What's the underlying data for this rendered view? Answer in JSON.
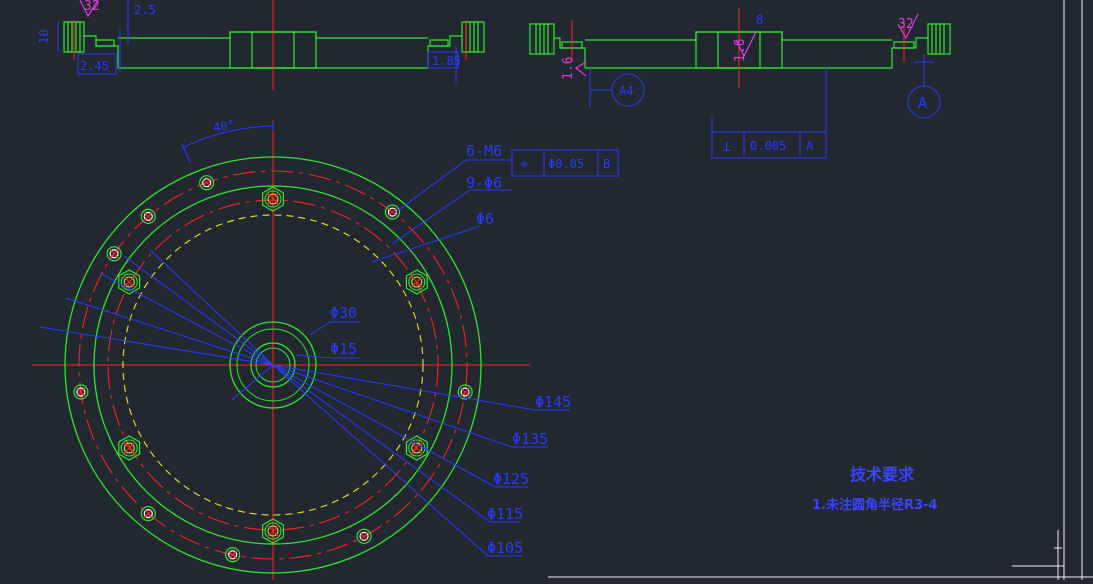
{
  "colors": {
    "background": "#212830",
    "outline": "#2ee82e",
    "centerline": "#ff2424",
    "dimension": "#2b3cff",
    "surface_finish": "#e23ce0",
    "hidden": "#e8e82a",
    "hole": "#ffffff"
  },
  "top_left_view": {
    "dims": {
      "height": "10",
      "gap": "2.5",
      "chamfer": "2.45",
      "right_detail": "1.85",
      "roughness": "32"
    }
  },
  "top_right_view": {
    "dims": {
      "roughness_center": "1.6",
      "top_value": "8",
      "roughness_left": "1.6",
      "roughness_right": "32",
      "datum_ref": "A4"
    },
    "datum_label": "A",
    "tolerance_frame": {
      "symbol": "⊥",
      "value": "0.005",
      "datum": "A"
    }
  },
  "plan_view": {
    "angle_label": "40°",
    "callouts": {
      "thread": "6-M6",
      "holes": "9-Φ6",
      "small_hole": "Φ6",
      "bore_outer": "Φ30",
      "bore_inner": "Φ15",
      "d145": "Φ145",
      "d135": "Φ135",
      "d125": "Φ125",
      "d115": "Φ115",
      "d105": "Φ105"
    },
    "position_frame": {
      "symbol": "⌖",
      "value": "Φ0.05",
      "datum": "B"
    }
  },
  "tech_notes": {
    "title": "技术要求",
    "line1": "1.未注圆角半径R3-4"
  }
}
